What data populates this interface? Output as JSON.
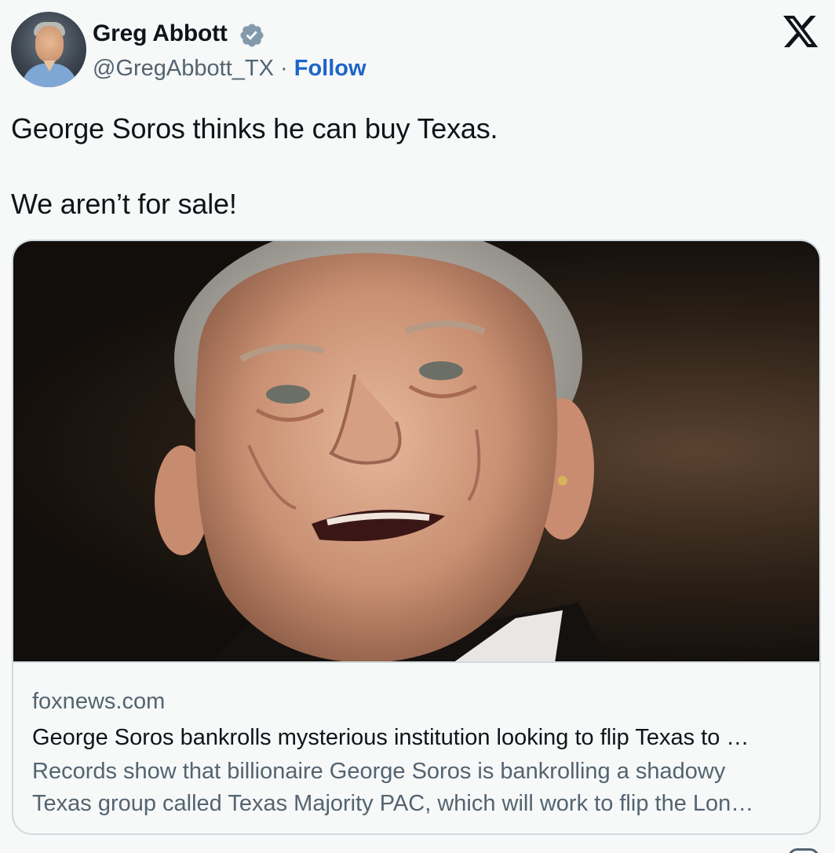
{
  "author": {
    "name": "Greg Abbott",
    "handle": "@GregAbbott_TX",
    "separator": "·",
    "follow_label": "Follow"
  },
  "icons": {
    "verified": "verified-badge-icon",
    "brand": "x-logo-icon"
  },
  "tweet": {
    "lines": [
      "George Soros thinks he can buy Texas.",
      "We aren’t for sale!"
    ]
  },
  "card": {
    "domain": "foxnews.com",
    "title": "George Soros bankrolls mysterious institution looking to flip Texas to …",
    "description_lines": [
      "Records show that billionaire George Soros is bankrolling a shadowy",
      "Texas group called Texas Majority PAC, which will work to flip the Lon…"
    ]
  },
  "colors": {
    "follow": "#1d64c9",
    "secondary_text": "#536471",
    "verified_badge": "#829aab"
  }
}
